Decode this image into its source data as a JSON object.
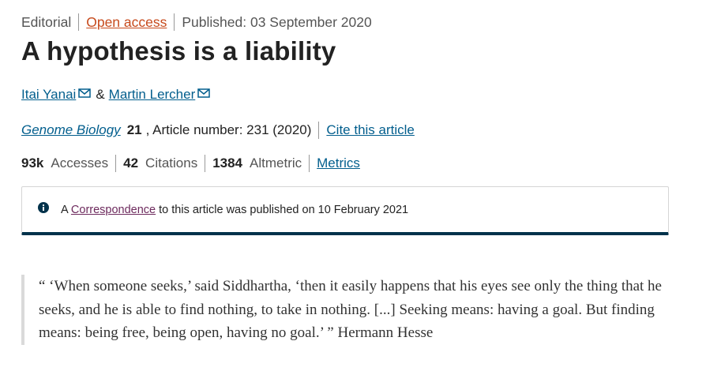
{
  "header": {
    "article_type": "Editorial",
    "access": "Open access",
    "published": "Published: 03 September 2020"
  },
  "title": "A hypothesis is a liability",
  "authors": [
    {
      "name": "Itai Yanai"
    },
    {
      "name": "Martin Lercher"
    }
  ],
  "author_separator": "&",
  "citation": {
    "journal": "Genome Biology",
    "volume": "21",
    "details": ", Article number: 231 (2020)",
    "cite_link": "Cite this article"
  },
  "metrics": {
    "accesses_count": "93k",
    "accesses_label": "Accesses",
    "citations_count": "42",
    "citations_label": "Citations",
    "altmetric_count": "1384",
    "altmetric_label": "Altmetric",
    "metrics_link": "Metrics"
  },
  "notice": {
    "prefix": "A",
    "link": "Correspondence",
    "suffix": "to this article was published on 10 February 2021"
  },
  "quote": {
    "text": "“ ‘When someone seeks,’ said Siddhartha, ‘then it easily happens that his eyes see only the thing that he seeks, and he is able to find nothing, to take in nothing. [...] Seeking means: having a goal. But finding means: being free, being open, having no goal.’ ” Hermann Hesse"
  },
  "icons": {
    "mail": "mail-icon",
    "info": "info-icon"
  },
  "colors": {
    "link": "#025e8d",
    "open_access": "#c74a1c",
    "notice_border": "#01324b",
    "correspondence_link": "#6d2a5d"
  }
}
